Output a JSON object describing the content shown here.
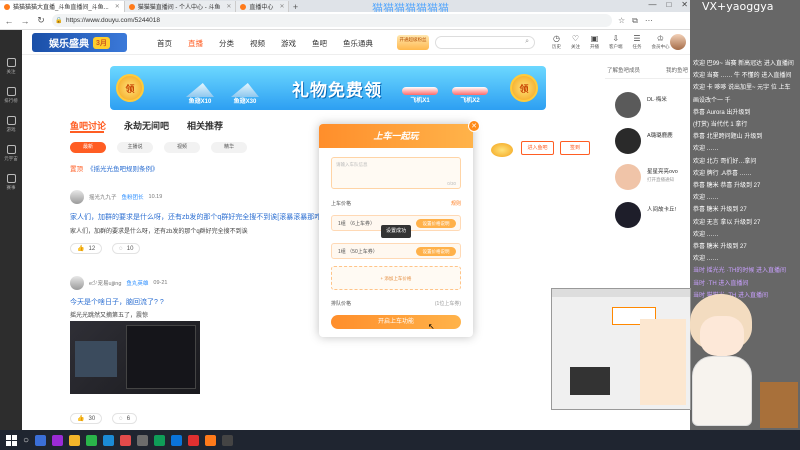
{
  "browser": {
    "tabs": [
      {
        "label": "猫猫猫猫大直播_斗鱼直播间_斗鱼..."
      },
      {
        "label": "猫猫猫直播间 - 个人中心 - 斗鱼"
      },
      {
        "label": "直播中心"
      }
    ],
    "url": "https://www.douyu.com/5244018",
    "overlay_text": "猫猫猫猫猫猫猫"
  },
  "left_rail": [
    {
      "label": "关注"
    },
    {
      "label": "排行榜"
    },
    {
      "label": "游戏"
    },
    {
      "label": "元宇宙"
    },
    {
      "label": "赛事"
    }
  ],
  "site": {
    "logo_text": "娱乐盛典",
    "logo_badge": "3月",
    "nav": [
      "首页",
      "直播",
      "分类",
      "视频",
      "游戏",
      "鱼吧",
      "鱼乐通典"
    ],
    "promo_chip": "开通超级粉丝",
    "header_icons": [
      "历史",
      "关注",
      "开播",
      "客户端",
      "任务",
      "会员中心"
    ]
  },
  "banner": {
    "coin_left": "领",
    "coin_right": "领",
    "title": "礼物免费领",
    "gifts": [
      "鱼翅X10",
      "鱼翅X30"
    ],
    "planes": [
      "飞机X1",
      "飞机X2"
    ]
  },
  "subtabs": [
    "鱼吧讨论",
    "永劫无间吧",
    "相关推荐"
  ],
  "pills": [
    "最新",
    "主播说",
    "视频",
    "精华"
  ],
  "pinned": {
    "tag": "置顶",
    "text": "《摇光光鱼吧规则条例》"
  },
  "posts": [
    {
      "author": "摇光九九子",
      "tag": "鱼粉团长",
      "time": "10.19",
      "title": "家人们，加群的要求是什么呀，还有zb发的那个q群好完全搜不到诶[滚暴滚暴那咋...",
      "body": "家人们，加群的要求是什么呀，还有zb发的那个q群好完全搜不到诶",
      "likes": "12",
      "comments": "10"
    },
    {
      "author": "e少宠易ujjing",
      "tag": "鱼丸英雄",
      "time": "09-21",
      "title": "今天是个啥日子，脑回流了? ?",
      "body": "摇光光跳然又摘第五了，震惊",
      "likes": "30",
      "comments": "6"
    }
  ],
  "modal": {
    "title": "上车一起玩",
    "placeholder": "请输入车队信息",
    "counter": "0/30",
    "section1": "上车价格",
    "section1_right": "规则",
    "rows": [
      {
        "text": "1组 （6上车券）",
        "button": "设置价格说明"
      },
      {
        "text": "1组 （50上车券）",
        "button": "设置价格说明"
      }
    ],
    "add_row": "+ 添加上车价格",
    "section2": "排队价格",
    "section2_right": "(1位上车券)",
    "tooltip": "设置成功",
    "submit": "开启上车功能"
  },
  "side_buttons": {
    "join": "进入鱼吧",
    "sign": "签到"
  },
  "follow_panel": {
    "tabs": [
      "了解鱼吧成员",
      "我的鱼吧"
    ],
    "items": [
      {
        "name": "DL·梅米",
        "sub": "",
        "color": "#5a5a5a"
      },
      {
        "name": "A璐璐鹿鹿",
        "sub": "",
        "color": "#2a2a2a"
      },
      {
        "name": "星星亮亮ovo",
        "sub": "打开直播通知",
        "color": "#f0c4a8"
      },
      {
        "name": "人间故卡丘!",
        "sub": "",
        "color": "#1e1e2a"
      }
    ]
  },
  "chat": {
    "title": "VX+yaoggya",
    "lines": [
      {
        "text": "欢迎 巴99~ 当赛 新高冠达 进入直播间",
        "cls": ""
      },
      {
        "text": "欢迎 当赛 …… 牛 不懂的 进入直播间",
        "cls": ""
      },
      {
        "text": "欢迎 卡 哆哆 说出加里~ 元宇 位 上车",
        "cls": ""
      },
      {
        "text": "画设改个一 千 ",
        "cls": ""
      },
      {
        "text": "恭喜 Aurora 出升级到 ",
        "cls": ""
      },
      {
        "text": "(打赏) 当代代 1 拿行",
        "cls": ""
      },
      {
        "text": "恭喜 北里跨问题山 升级到 ",
        "cls": ""
      },
      {
        "text": "欢迎 ……",
        "cls": ""
      },
      {
        "text": "欢迎 北方 哥们好…拿问",
        "cls": ""
      },
      {
        "text": "欢迎 牌行 .A恭喜 ……",
        "cls": ""
      },
      {
        "text": "恭喜 糖米 恭喜 升级到 27",
        "cls": ""
      },
      {
        "text": "欢迎 ……",
        "cls": ""
      },
      {
        "text": "恭喜 糖米 升级到 27",
        "cls": ""
      },
      {
        "text": "欢迎 无言 拿以 升级到 27",
        "cls": ""
      },
      {
        "text": "欢迎 ……",
        "cls": ""
      },
      {
        "text": "恭喜 糖米 升级到 27",
        "cls": ""
      },
      {
        "text": "欢迎 ……",
        "cls": ""
      },
      {
        "text": "当时 摇光光 ·TH的时候 进入直播间",
        "cls": "purple"
      },
      {
        "text": "当时 ·TH 进入直播间",
        "cls": "purple"
      },
      {
        "text": "当时 猫猫光 ·TH 进入直播间",
        "cls": "purple"
      }
    ]
  },
  "taskbar": {
    "search_glyph": "○"
  }
}
